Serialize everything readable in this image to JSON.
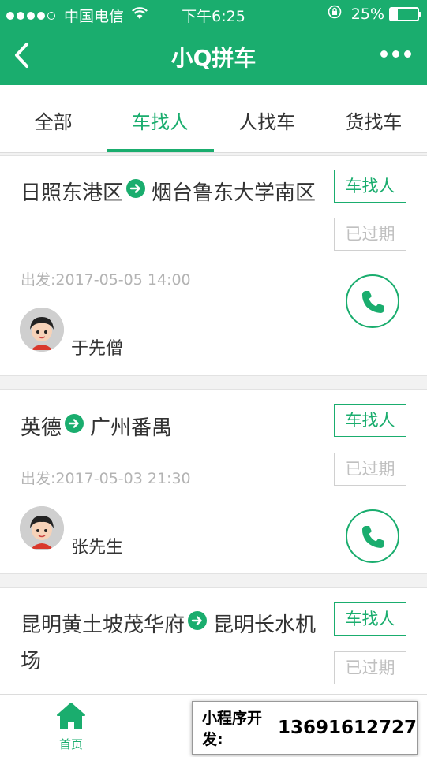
{
  "status_bar": {
    "carrier": "中国电信",
    "time": "下午6:25",
    "battery": "25%",
    "battery_level": 0.25
  },
  "nav": {
    "title": "小Q拼车"
  },
  "tabs": [
    {
      "label": "全部"
    },
    {
      "label": "车找人"
    },
    {
      "label": "人找车"
    },
    {
      "label": "货找车"
    }
  ],
  "active_tab": "车找人",
  "trips": [
    {
      "from": "日照东港区",
      "to": "烟台鲁东大学南区",
      "type_tag": "车找人",
      "status_tag": "已过期",
      "depart": "出发:2017-05-05 14:00",
      "name": "于先僧"
    },
    {
      "from": "英德",
      "to": "广州番禺",
      "type_tag": "车找人",
      "status_tag": "已过期",
      "depart": "出发:2017-05-03 21:30",
      "name": "张先生"
    },
    {
      "from": "昆明黄土坡茂华府",
      "to": "昆明长水机场",
      "type_tag": "车找人",
      "status_tag": "已过期"
    }
  ],
  "tabbar": {
    "home_label": "首页"
  },
  "watermark": {
    "label": "小程序开发:",
    "number": "13691612727"
  },
  "colors": {
    "brand": "#1aad6e",
    "expired": "#c0c0c0"
  }
}
